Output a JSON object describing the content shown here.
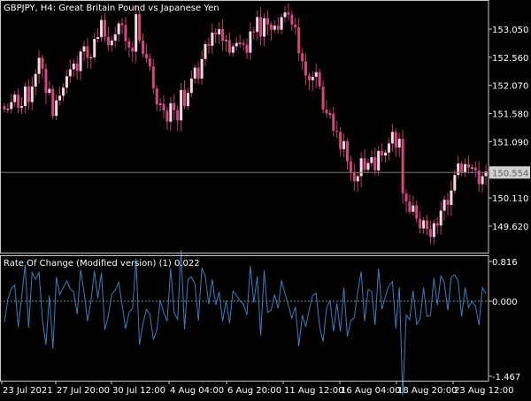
{
  "colors": {
    "background": "#000000",
    "frame": "#c8c8c8",
    "text": "#ffffff",
    "bull_body": "#f7d8e4",
    "bear_body": "#d2477d",
    "wick": "#c43a73",
    "indicator_line": "#3c7fbf",
    "zero_line": "#6a8fb5",
    "current_price_line": "#7a7a7a",
    "current_price_badge_bg": "#d0d0d0",
    "current_price_badge_text": "#606060"
  },
  "main_panel": {
    "title": "GBPJPY, H4:  Great Britain Pound vs Japanese Yen",
    "price_ticks": [
      "153.050",
      "152.560",
      "152.070",
      "151.580",
      "151.090",
      "150.600",
      "150.110",
      "149.620"
    ],
    "current_price": "150.554"
  },
  "indicator_panel": {
    "title": "Rate Of Change (Modified version) (1) 0.022",
    "ticks": [
      "0.816",
      "0.000",
      "-1.467"
    ]
  },
  "time_axis": {
    "labels": [
      "23 Jul 2021",
      "27 Jul 20:00",
      "30 Jul 12:00",
      "4 Aug 04:00",
      "6 Aug 20:00",
      "11 Aug 12:00",
      "16 Aug 04:00",
      "18 Aug 20:00",
      "23 Aug 12:00"
    ]
  },
  "chart_data": [
    {
      "type": "candlestick",
      "title": "GBPJPY, H4:  Great Britain Pound vs Japanese Yen",
      "x_range": [
        "23 Jul 2021",
        "23 Aug 2021"
      ],
      "ylim": [
        149.35,
        153.4
      ],
      "current_price": 150.554,
      "series": [
        {
          "name": "",
          "close": [
            151.65,
            151.66,
            151.78,
            151.91,
            151.68,
            151.71,
            152.05,
            151.78,
            152.05,
            152.27,
            152.55,
            152.36,
            151.94,
            152.01,
            151.54,
            151.81,
            151.89,
            152.03,
            152.23,
            152.35,
            152.45,
            152.32,
            152.66,
            152.75,
            152.55,
            152.56,
            152.88,
            152.91,
            153.21,
            152.92,
            152.77,
            152.85,
            152.96,
            153.15,
            153.12,
            152.84,
            152.73,
            152.66,
            153.31,
            152.85,
            152.62,
            152.54,
            152.4,
            152.02,
            151.74,
            151.75,
            151.63,
            151.44,
            151.76,
            151.64,
            151.46,
            151.99,
            151.71,
            151.94,
            152.19,
            152.38,
            152.19,
            152.53,
            152.79,
            152.76,
            152.99,
            152.96,
            153.05,
            152.85,
            152.86,
            152.64,
            152.75,
            152.81,
            152.81,
            152.78,
            152.64,
            153.01,
            153.0,
            153.26,
            152.92,
            153.24,
            153.13,
            153.04,
            153.11,
            153.04,
            153.26,
            153.34,
            153.3,
            153.13,
            153.08,
            152.63,
            152.49,
            152.24,
            152.16,
            152.22,
            152.3,
            152.05,
            151.65,
            151.58,
            151.58,
            151.28,
            151.26,
            150.96,
            151.1,
            150.75,
            150.56,
            150.4,
            150.49,
            150.8,
            150.6,
            150.72,
            150.82,
            150.59,
            150.93,
            150.85,
            150.9,
            151.06,
            151.26,
            150.99,
            151.14,
            150.19,
            150.05,
            149.87,
            149.98,
            149.75,
            149.58,
            149.72,
            149.57,
            149.43,
            149.67,
            149.63,
            149.89,
            150.08,
            149.99,
            150.24,
            150.51,
            150.71,
            150.56,
            150.7,
            150.64,
            150.64,
            150.59,
            150.35,
            150.49,
            150.57
          ]
        }
      ]
    },
    {
      "type": "line",
      "title": "Rate Of Change (Modified version) (1) 0.022",
      "ylim": [
        -1.467,
        0.816
      ],
      "ticks": [
        0.816,
        0.0,
        -1.467
      ],
      "series": [
        {
          "name": "",
          "values": [
            -0.41,
            0.04,
            0.26,
            0.33,
            -0.51,
            0.08,
            0.75,
            -0.52,
            0.59,
            0.45,
            0.59,
            -0.37,
            -0.85,
            0.12,
            -0.93,
            0.49,
            0.14,
            0.28,
            0.42,
            0.25,
            0.2,
            -0.25,
            0.65,
            0.18,
            -0.39,
            0.01,
            0.62,
            0.06,
            0.59,
            -0.56,
            -0.29,
            0.15,
            0.22,
            0.39,
            -0.07,
            -0.54,
            -0.22,
            -0.14,
            0.88,
            -0.85,
            -0.44,
            -0.16,
            -0.26,
            -0.75,
            -0.57,
            0.02,
            -0.23,
            -0.39,
            0.67,
            -0.23,
            -0.36,
            1.05,
            -0.55,
            0.45,
            0.5,
            0.36,
            -0.38,
            0.68,
            0.51,
            -0.06,
            0.45,
            -0.07,
            0.19,
            -0.39,
            0.01,
            -0.43,
            0.21,
            0.12,
            0.01,
            -0.06,
            -0.27,
            0.72,
            -0.03,
            0.51,
            -0.67,
            0.63,
            -0.22,
            -0.17,
            0.14,
            -0.14,
            0.43,
            0.16,
            -0.08,
            -0.33,
            -0.11,
            -0.88,
            -0.27,
            -0.5,
            -0.16,
            0.12,
            0.16,
            -0.5,
            -0.79,
            -0.14,
            0.01,
            -0.59,
            -0.04,
            -0.59,
            0.28,
            -0.69,
            -0.38,
            -0.32,
            0.18,
            0.61,
            -0.39,
            0.24,
            0.2,
            -0.46,
            0.67,
            -0.16,
            0.1,
            0.31,
            0.4,
            -0.53,
            0.29,
            -1.84,
            -0.27,
            -0.36,
            0.22,
            -0.45,
            -0.34,
            0.28,
            -0.3,
            -0.28,
            0.48,
            -0.08,
            0.52,
            0.38,
            -0.18,
            0.5,
            0.54,
            0.41,
            -0.3,
            0.28,
            -0.12,
            0.0,
            -0.1,
            -0.47,
            0.28,
            0.16
          ]
        }
      ]
    }
  ]
}
